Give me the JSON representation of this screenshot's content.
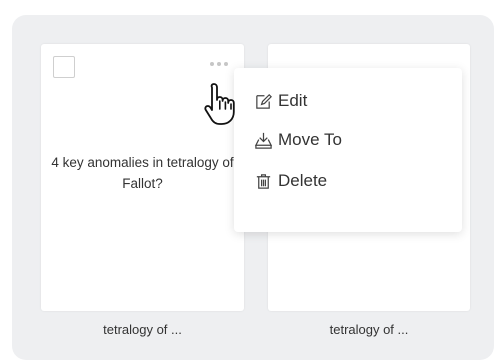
{
  "cards": [
    {
      "question": "4 key anomalies in tetralogy of Fallot?",
      "caption": "tetralogy of ..."
    },
    {
      "question": "",
      "caption": "tetralogy of ..."
    }
  ],
  "context_menu": {
    "edit_label": "Edit",
    "move_label": "Move To",
    "delete_label": "Delete"
  },
  "icons": {
    "more": "more-horizontal-icon",
    "edit": "edit-pencil-icon",
    "move": "move-to-icon",
    "delete": "trash-icon",
    "cursor": "hand-pointer-cursor"
  }
}
